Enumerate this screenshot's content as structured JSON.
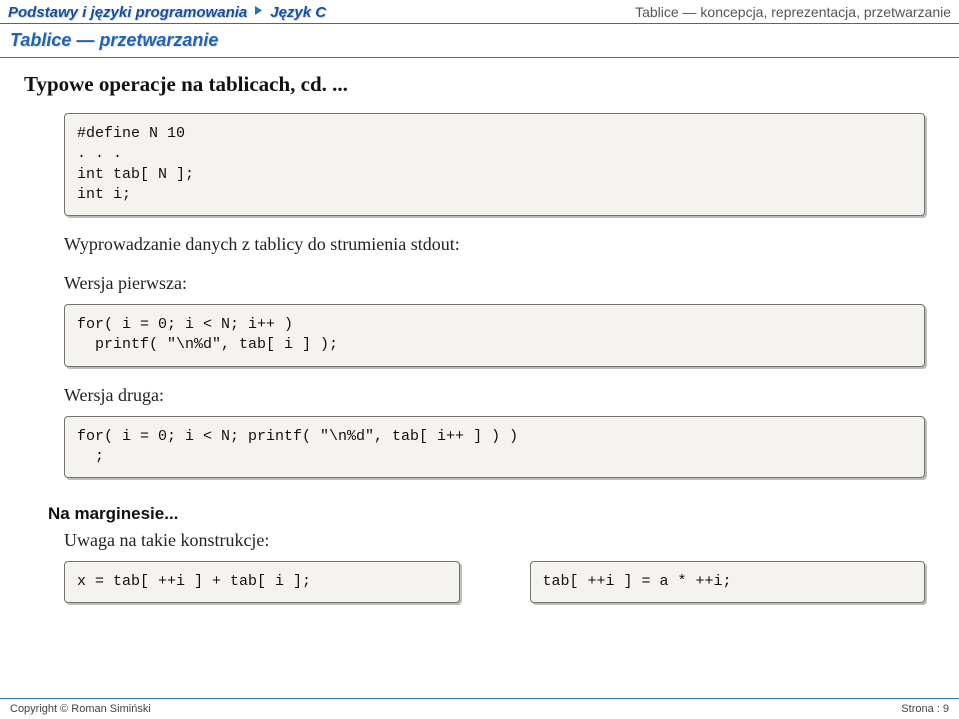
{
  "header": {
    "left1": "Podstawy i języki programowania",
    "left2": "Język C",
    "right": "Tablice — koncepcja, reprezentacja, przetwarzanie"
  },
  "subheader": "Tablice — przetwarzanie",
  "title": "Typowe operacje na tablicach, cd. ...",
  "code1": "#define N 10\n. . .\nint tab[ N ];\nint i;",
  "desc1": "Wyprowadzanie danych z tablicy do strumienia stdout:",
  "ver1_label": "Wersja pierwsza:",
  "code2": "for( i = 0; i < N; i++ )\n  printf( \"\\n%d\", tab[ i ] );",
  "ver2_label": "Wersja druga:",
  "code3": "for( i = 0; i < N; printf( \"\\n%d\", tab[ i++ ] ) )\n  ;",
  "margin_label": "Na marginesie...",
  "margin_sub": "Uwaga na takie konstrukcje:",
  "code4": "x = tab[ ++i ] + tab[ i ];",
  "code5": "tab[ ++i ] = a * ++i;",
  "footer": {
    "left": "Copyright © Roman Simiński",
    "right": "Strona : 9"
  }
}
